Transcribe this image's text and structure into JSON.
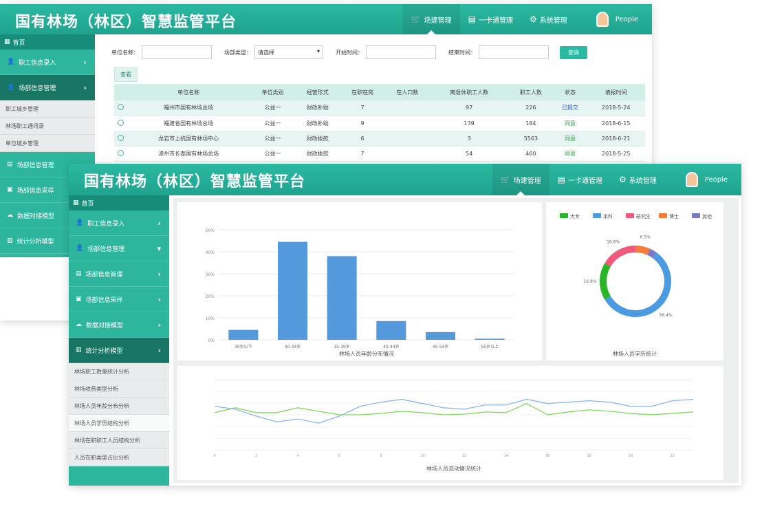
{
  "app_title": "国有林场（林区）智慧监管平台",
  "nav": [
    {
      "label": "场建管理",
      "icon": "cart-icon"
    },
    {
      "label": "一卡通管理",
      "icon": "card-icon"
    },
    {
      "label": "系统管理",
      "icon": "gear-icon"
    }
  ],
  "user": {
    "name": "People"
  },
  "sidebar": {
    "home": "首页",
    "items": [
      {
        "label": "职工信息录入"
      },
      {
        "label": "场部信息管理"
      },
      {
        "label": "场部信息管理"
      },
      {
        "label": "场部信息采样"
      },
      {
        "label": "数据对接模型"
      },
      {
        "label": "统计分析模型"
      }
    ],
    "back_submenu": [
      "职工城乡管理",
      "林场职工通讯录",
      "单位城乡管理"
    ],
    "front_submenu": [
      "林场职工数量统计分析",
      "林场收费类型分析",
      "林场人员年龄分布分析",
      "林场人员学历结构分析",
      "林场在职职工人员结构分析",
      "人员在职类型占比分析"
    ]
  },
  "search": {
    "f1": "单位名称：",
    "f2": "场部类型：",
    "f2_value": "请选择",
    "f3": "开始时间：",
    "f4": "结束时间：",
    "button": "查询"
  },
  "tag": "查看",
  "table": {
    "headers": [
      "",
      "单位名称",
      "单位类别",
      "经营形式",
      "在职在岗",
      "在人口数",
      "离退休职工人数",
      "职工人数",
      "状态",
      "填报时间"
    ],
    "rows": [
      {
        "name": "福州市国有林场总场",
        "type": "公益一",
        "form": "财政补助",
        "c1": "7",
        "c2": "",
        "c3": "97",
        "c4": "226",
        "status": "已提交",
        "date": "2018-5-24",
        "st": "blue"
      },
      {
        "name": "福建省国有林场总场",
        "type": "公益一",
        "form": "财政补助",
        "c1": "9",
        "c2": "",
        "c3": "139",
        "c4": "184",
        "status": "同意",
        "date": "2018-6-15",
        "st": "green"
      },
      {
        "name": "龙岩市上杭国有林场中心",
        "type": "公益一",
        "form": "财政拨款",
        "c1": "6",
        "c2": "",
        "c3": "3",
        "c4": "5563",
        "status": "同意",
        "date": "2018-6-21",
        "st": "green"
      },
      {
        "name": "漳州市长泰国有林场总场",
        "type": "公益一",
        "form": "财政拨款",
        "c1": "7",
        "c2": "",
        "c3": "54",
        "c4": "460",
        "status": "同意",
        "date": "2018-5-25",
        "st": "green"
      }
    ]
  },
  "colors": {
    "teal": "#22a98f",
    "bar": "#5399db",
    "green": "#7ed957",
    "blue": "#8ab5ef"
  },
  "chart_data": [
    {
      "type": "bar",
      "categories": [
        "30岁以下",
        "30-34岁",
        "35-39岁",
        "40-44岁",
        "45-54岁",
        "55岁以上"
      ],
      "values": [
        4.5,
        44.5,
        38,
        8.5,
        3.5,
        0.5
      ],
      "ylim": [
        0,
        50
      ],
      "yticks": [
        "0%",
        "10%",
        "20%",
        "30%",
        "40%",
        "50%"
      ],
      "xlabel": "林场人员年龄分布情况"
    },
    {
      "type": "pie",
      "legend": [
        "大专",
        "本科",
        "研究生",
        "博士",
        "其他"
      ],
      "values": [
        16.9,
        56.4,
        16.8,
        6.5,
        3.4
      ],
      "slice_colors": [
        "#28b627",
        "#4c9ae0",
        "#f05a7a",
        "#f77b36",
        "#7779c9"
      ],
      "slice_labels": [
        "16.9%",
        "56.4%",
        "16.8%",
        "6.5%",
        ""
      ],
      "caption": "林场人员学历统计"
    },
    {
      "type": "line",
      "x": [
        0,
        2,
        4,
        6,
        8,
        10,
        12,
        14,
        16,
        18,
        20,
        22
      ],
      "series": [
        {
          "name": "",
          "values": [
            53,
            60,
            53,
            53,
            60,
            55,
            50,
            50,
            52,
            55,
            53,
            50,
            51,
            54,
            53,
            66,
            50,
            54,
            57,
            55,
            52,
            50,
            52,
            54
          ]
        },
        {
          "name": "",
          "values": [
            62,
            58,
            48,
            40,
            44,
            38,
            48,
            62,
            68,
            72,
            66,
            60,
            58,
            64,
            64,
            72,
            66,
            68,
            70,
            68,
            62,
            62,
            70,
            72
          ]
        }
      ],
      "caption": "林场人员流动情况统计"
    }
  ]
}
